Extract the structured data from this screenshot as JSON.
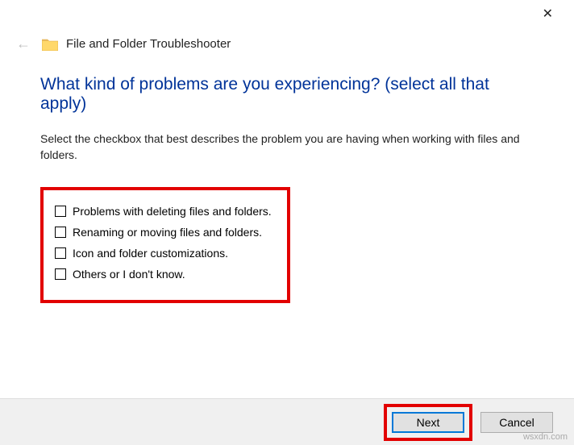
{
  "titlebar": {
    "close_glyph": "✕"
  },
  "header": {
    "back_glyph": "←",
    "title": "File and Folder Troubleshooter"
  },
  "main": {
    "heading": "What kind of problems are you experiencing? (select all that apply)",
    "subtext": "Select the checkbox that best describes the problem you are having when working with files and folders."
  },
  "options": [
    {
      "label": "Problems with deleting files and folders."
    },
    {
      "label": "Renaming or moving files and folders."
    },
    {
      "label": "Icon and folder customizations."
    },
    {
      "label": "Others or I don't know."
    }
  ],
  "footer": {
    "next_label": "Next",
    "cancel_label": "Cancel"
  },
  "watermark": "wsxdn.com"
}
